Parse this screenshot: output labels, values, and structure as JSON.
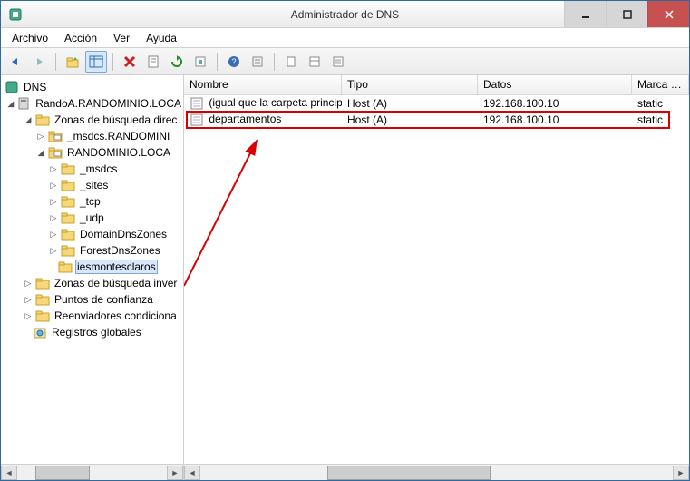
{
  "window": {
    "title": "Administrador de DNS"
  },
  "menu": {
    "archivo": "Archivo",
    "accion": "Acción",
    "ver": "Ver",
    "ayuda": "Ayuda"
  },
  "tree": {
    "root": "DNS",
    "server": "RandoA.RANDOMINIO.LOCA",
    "forward": "Zonas de búsqueda direc",
    "msdcs": "_msdcs.RANDOMINI",
    "domain": "RANDOMINIO.LOCA",
    "sub_msdcs": "_msdcs",
    "sub_sites": "_sites",
    "sub_tcp": "_tcp",
    "sub_udp": "_udp",
    "sub_domaindns": "DomainDnsZones",
    "sub_forestdns": "ForestDnsZones",
    "sub_ies": "iesmontesclaros",
    "reverse": "Zonas de búsqueda inver",
    "trust": "Puntos de confianza",
    "forwarders": "Reenviadores condiciona",
    "global": "Registros globales"
  },
  "list": {
    "headers": {
      "nombre": "Nombre",
      "tipo": "Tipo",
      "datos": "Datos",
      "marca": "Marca de"
    },
    "rows": [
      {
        "nombre": "(igual que la carpeta princip...",
        "tipo": "Host (A)",
        "datos": "192.168.100.10",
        "marca": "static"
      },
      {
        "nombre": "departamentos",
        "tipo": "Host (A)",
        "datos": "192.168.100.10",
        "marca": "static"
      }
    ]
  }
}
